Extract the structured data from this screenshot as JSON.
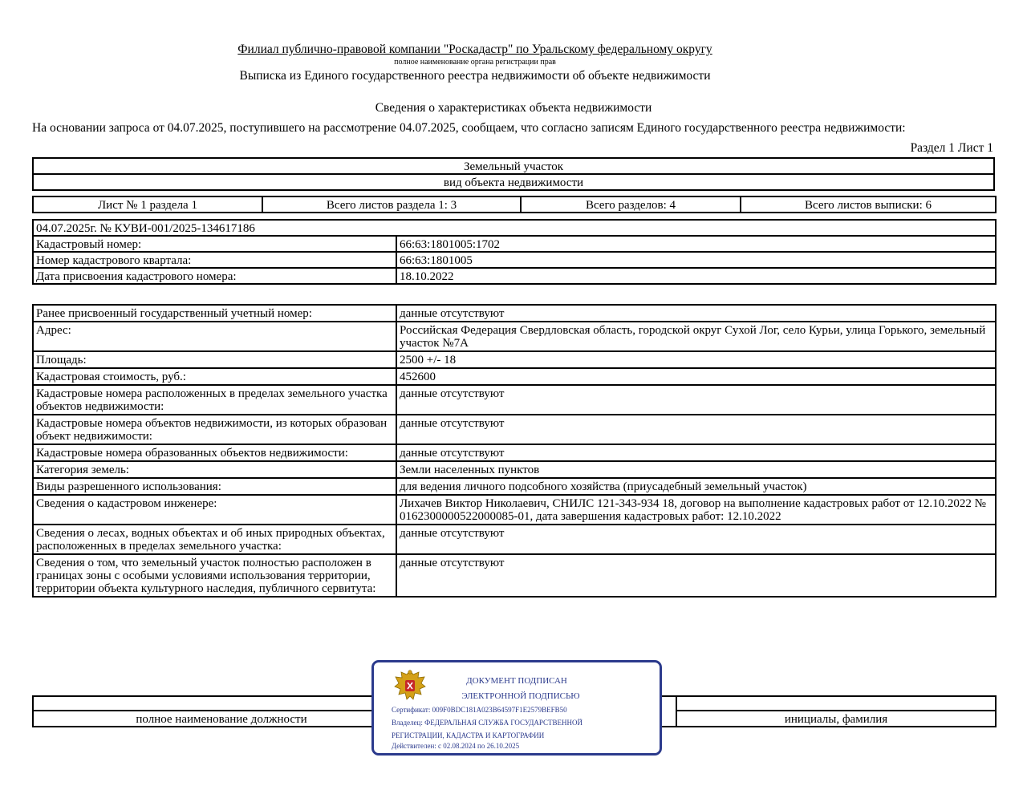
{
  "header": {
    "organization": "Филиал публично-правовой компании \"Роскадастр\" по Уральскому федеральному округу",
    "organization_note": "полное наименование органа регистрации прав",
    "document_title": "Выписка из Единого государственного реестра недвижимости об объекте недвижимости"
  },
  "section_title": "Сведения о характеристиках объекта недвижимости",
  "basis_text": "На  основании запроса от 04.07.2025, поступившего на рассмотрение 04.07.2025, сообщаем, что согласно записям Единого государственного реестра недвижимости:",
  "sheet_ref": "Раздел 1 Лист 1",
  "object": {
    "kind": "Земельный участок",
    "kind_caption": "вид объекта недвижимости"
  },
  "sheets": {
    "sheet_no": "Лист № 1 раздела 1",
    "total_sheets_section": "Всего листов раздела 1: 3",
    "total_sections": "Всего разделов: 4",
    "total_sheets_extract": "Всего листов выписки: 6"
  },
  "identification": {
    "record": "04.07.2025г. № КУВИ-001/2025-134617186",
    "rows": [
      {
        "label": "Кадастровый номер:",
        "value": "66:63:1801005:1702"
      },
      {
        "label": "Номер кадастрового квартала:",
        "value": "66:63:1801005"
      },
      {
        "label": "Дата присвоения кадастрового номера:",
        "value": "18.10.2022"
      }
    ]
  },
  "details": [
    {
      "label": "Ранее присвоенный государственный учетный номер:",
      "value": "данные отсутствуют"
    },
    {
      "label": "Адрес:",
      "value": "Российская Федерация Свердловская область, городской округ Сухой Лог, село Курьи, улица Горького, земельный участок №7А"
    },
    {
      "label": "Площадь:",
      "value": "2500 +/- 18"
    },
    {
      "label": "Кадастровая стоимость, руб.:",
      "value": "452600"
    },
    {
      "label": "Кадастровые номера расположенных в пределах земельного участка объектов недвижимости:",
      "value": "данные отсутствуют"
    },
    {
      "label": "Кадастровые номера объектов недвижимости, из которых образован объект недвижимости:",
      "value": "данные отсутствуют"
    },
    {
      "label": "Кадастровые номера образованных объектов недвижимости:",
      "value": "данные отсутствуют"
    },
    {
      "label": "Категория земель:",
      "value": "Земли населенных пунктов"
    },
    {
      "label": "Виды разрешенного использования:",
      "value": "для ведения личного подсобного хозяйства (приусадебный земельный участок)"
    },
    {
      "label": "Сведения о кадастровом инженере:",
      "value": "Лихачев Виктор Николаевич, СНИЛС 121-343-934 18, договор на выполнение кадастровых работ от 12.10.2022 № 0162300000522000085-01, дата завершения кадастровых работ: 12.10.2022"
    },
    {
      "label": "Сведения о лесах, водных объектах и об иных природных объектах, расположенных в пределах земельного участка:",
      "value": "данные отсутствуют"
    },
    {
      "label": "Сведения о том, что земельный участок полностью расположен в границах зоны с особыми условиями использования территории, территории объекта культурного наследия, публичного сервитута:",
      "value": "данные отсутствуют"
    }
  ],
  "signature": {
    "position_caption": "полное наименование должности",
    "name_caption": "инициалы, фамилия"
  },
  "stamp": {
    "line1": "ДОКУМЕНТ ПОДПИСАН",
    "line2": "ЭЛЕКТРОННОЙ ПОДПИСЬЮ",
    "certificate": "Сертификат: 009F0BDC181A023B64597F1E2579BEFB50",
    "owner": "Владелец: ФЕДЕРАЛЬНАЯ СЛУЖБА ГОСУДАРСТВЕННОЙ",
    "owner2": "РЕГИСТРАЦИИ, КАДАСТРА И КАРТОГРАФИИ",
    "validity": "Действителен: с 02.08.2024 по 26.10.2025",
    "accent_color": "#2b3a8c",
    "emblem_icon": "double-headed-eagle-emblem"
  }
}
